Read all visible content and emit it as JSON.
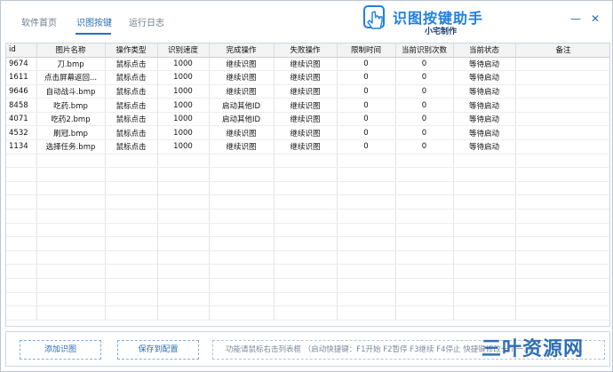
{
  "header": {
    "tabs": [
      {
        "label": "软件首页"
      },
      {
        "label": "识图按键"
      },
      {
        "label": "运行日志"
      }
    ],
    "active_tab": "识图按键",
    "app_title": "识图按键助手",
    "app_subtitle": "小宅制作",
    "minimize": "—",
    "close": "✕"
  },
  "table": {
    "columns": [
      "id",
      "图片名称",
      "操作类型",
      "识别速度",
      "完成操作",
      "失败操作",
      "限制时间",
      "当前识别次数",
      "当前状态",
      "备注"
    ],
    "rows": [
      [
        "9674",
        "刀.bmp",
        "鼠标点击",
        "1000",
        "继续识图",
        "继续识图",
        "0",
        "0",
        "等待启动",
        ""
      ],
      [
        "1611",
        "点击屏幕返回...",
        "鼠标点击",
        "1000",
        "继续识图",
        "继续识图",
        "0",
        "0",
        "等待启动",
        ""
      ],
      [
        "9646",
        "自动战斗.bmp",
        "鼠标点击",
        "1000",
        "继续识图",
        "继续识图",
        "0",
        "0",
        "等待启动",
        ""
      ],
      [
        "8458",
        "吃药.bmp",
        "鼠标点击",
        "1000",
        "启动其他ID",
        "继续识图",
        "0",
        "0",
        "等待启动",
        ""
      ],
      [
        "4071",
        "吃药2.bmp",
        "鼠标点击",
        "1000",
        "启动其他ID",
        "继续识图",
        "0",
        "0",
        "等待启动",
        ""
      ],
      [
        "4532",
        "刷冠.bmp",
        "鼠标点击",
        "1000",
        "继续识图",
        "继续识图",
        "0",
        "0",
        "等待启动",
        ""
      ],
      [
        "1134",
        "选择任务.bmp",
        "鼠标点击",
        "1000",
        "继续识图",
        "继续识图",
        "0",
        "0",
        "等待启动",
        ""
      ]
    ]
  },
  "bottom": {
    "add_button": "添加识图",
    "save_button": "保存到配置",
    "hint": "功能请鼠标右击列表框 （启动快捷键：F1开始 F2暂停 F3继续 F4停止 快捷键修改一个一..."
  },
  "watermark": "三叶资源网",
  "colors": {
    "accent": "#2b6fb4",
    "logo": "#1e7fe0"
  }
}
